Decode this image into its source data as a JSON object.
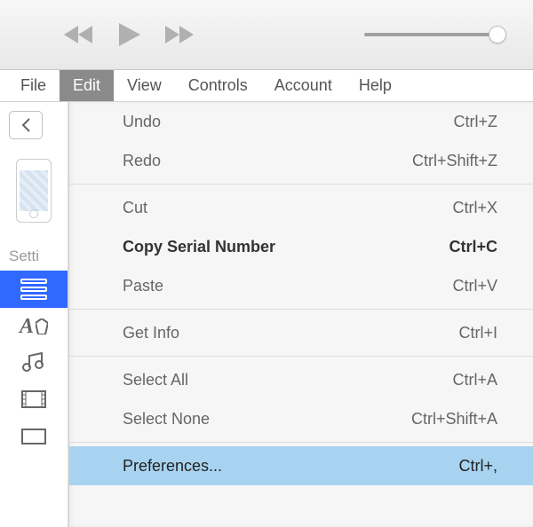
{
  "menubar": {
    "items": [
      "File",
      "Edit",
      "View",
      "Controls",
      "Account",
      "Help"
    ],
    "active": "Edit"
  },
  "sidebar": {
    "settings_label": "Setti"
  },
  "edit_menu": {
    "items": [
      {
        "label": "Undo",
        "shortcut": "Ctrl+Z",
        "bold": false
      },
      {
        "label": "Redo",
        "shortcut": "Ctrl+Shift+Z",
        "bold": false
      },
      {
        "separator": true
      },
      {
        "label": "Cut",
        "shortcut": "Ctrl+X",
        "bold": false
      },
      {
        "label": "Copy Serial Number",
        "shortcut": "Ctrl+C",
        "bold": true
      },
      {
        "label": "Paste",
        "shortcut": "Ctrl+V",
        "bold": false
      },
      {
        "separator": true
      },
      {
        "label": "Get Info",
        "shortcut": "Ctrl+I",
        "bold": false
      },
      {
        "separator": true
      },
      {
        "label": "Select All",
        "shortcut": "Ctrl+A",
        "bold": false
      },
      {
        "label": "Select None",
        "shortcut": "Ctrl+Shift+A",
        "bold": false
      },
      {
        "separator": true
      },
      {
        "label": "Preferences...",
        "shortcut": "Ctrl+,",
        "bold": false,
        "highlight": true
      }
    ]
  }
}
